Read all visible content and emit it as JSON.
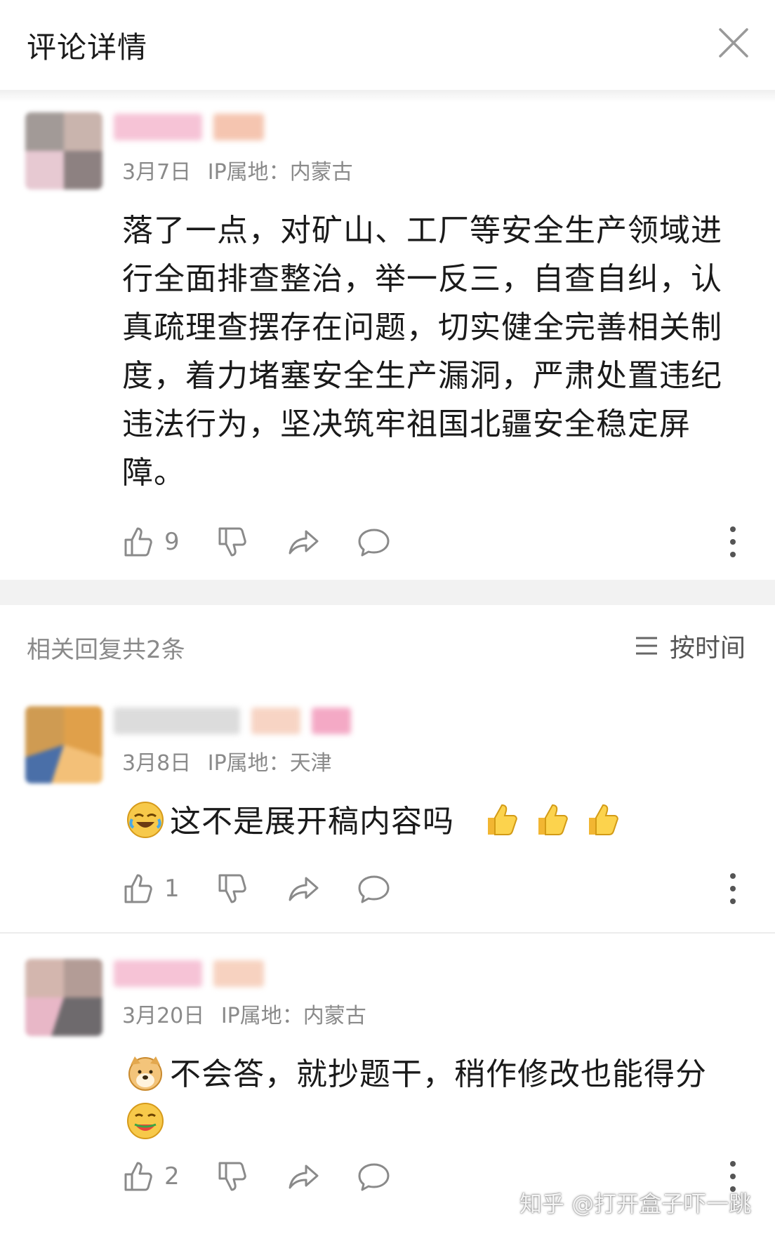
{
  "header": {
    "title": "评论详情"
  },
  "main_comment": {
    "date": "3月7日",
    "ip_label": "IP属地：",
    "ip_location": "内蒙古",
    "text": "落了一点，对矿山、工厂等安全生产领域进行全面排查整治，举一反三，自查自纠，认真疏理查摆存在问题，切实健全完善相关制度，着力堵塞安全生产漏洞，严肃处置违纪违法行为，坚决筑牢祖国北疆安全稳定屏障。",
    "likes": "9"
  },
  "replies": {
    "title": "相关回复共2条",
    "sort_label": "按时间",
    "items": [
      {
        "date": "3月8日",
        "ip_label": "IP属地：",
        "ip_location": "天津",
        "text": "这不是展开稿内容吗",
        "likes": "1"
      },
      {
        "date": "3月20日",
        "ip_label": "IP属地：",
        "ip_location": "内蒙古",
        "text": "不会答，就抄题干，稍作修改也能得分",
        "likes": "2"
      }
    ]
  },
  "watermark": "知乎 @打开盒子吓一跳"
}
